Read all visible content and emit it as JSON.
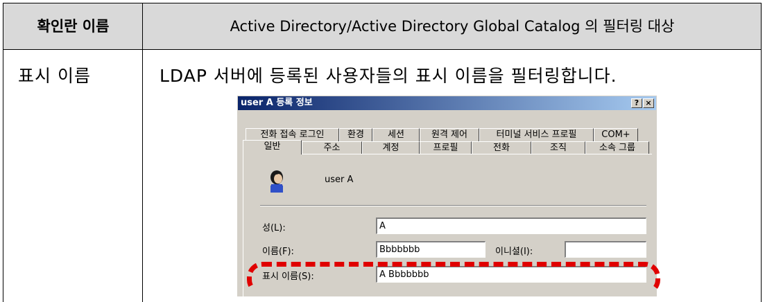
{
  "table": {
    "header_col1": "확인란 이름",
    "header_col2": "Active Directory/Active Directory Global Catalog 의 필터링 대상",
    "row_label": "표시 이름",
    "row_description": "LDAP 서버에 등록된 사용자들의 표시 이름을 필터링합니다."
  },
  "dialog": {
    "title": "user A 등록 정보",
    "help_button": "?",
    "close_button": "×",
    "tabs_row1": [
      "전화 접속 로그인",
      "환경",
      "세션",
      "원격 제어",
      "터미널 서비스 프로필",
      "COM+"
    ],
    "tabs_row2": [
      "일반",
      "주소",
      "계정",
      "프로필",
      "전화",
      "조직",
      "소속 그룹"
    ],
    "active_tab": "일반",
    "user_name": "user A",
    "fields": {
      "last_name_label": "성(L):",
      "last_name_value": "A",
      "first_name_label": "이름(F):",
      "first_name_value": "Bbbbbbb",
      "initials_label": "이니셜(I):",
      "initials_value": "",
      "display_name_label": "표시 이름(S):",
      "display_name_value": "A Bbbbbbb"
    },
    "highlight_color": "#e00000"
  }
}
